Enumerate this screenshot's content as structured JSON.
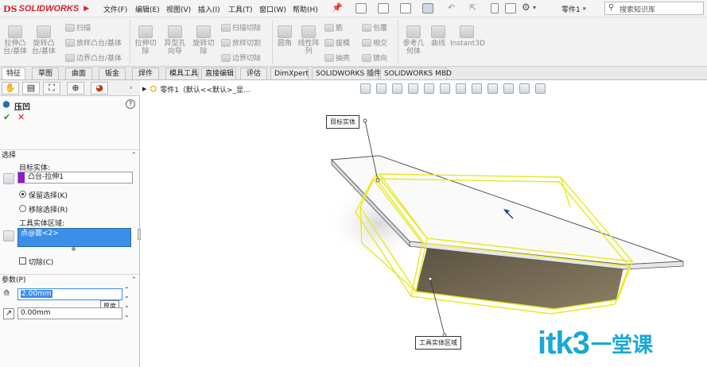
{
  "app": {
    "brand_ds": "DS",
    "brand_name": "SOLIDWORKS"
  },
  "menubar": {
    "items": [
      "文件(F)",
      "编辑(E)",
      "视图(V)",
      "插入(I)",
      "工具(T)",
      "窗口(W)",
      "帮助(H)"
    ],
    "document_name": "零件1 *",
    "search_placeholder": "搜索知识库"
  },
  "ribbon": {
    "large_buttons": [
      {
        "label": "拉伸凸\n台/基体",
        "icon": "extruded-boss-icon"
      },
      {
        "label": "旋转凸\n台/基体",
        "icon": "revolved-boss-icon"
      },
      {
        "label": "拉伸切\n除",
        "icon": "extruded-cut-icon"
      },
      {
        "label": "异型孔\n向导",
        "icon": "hole-wizard-icon"
      },
      {
        "label": "旋转切\n除",
        "icon": "revolved-cut-icon"
      },
      {
        "label": "圆角",
        "icon": "fillet-icon"
      },
      {
        "label": "线性阵\n列",
        "icon": "linear-pattern-icon"
      },
      {
        "label": "参考几\n何体",
        "icon": "reference-geometry-icon"
      },
      {
        "label": "曲线",
        "icon": "curves-icon"
      },
      {
        "label": "Instant3D",
        "icon": "instant3d-icon"
      }
    ],
    "small_buttons": [
      {
        "label": "扫描",
        "icon": "sweep-icon"
      },
      {
        "label": "放样凸台/基体",
        "icon": "loft-icon"
      },
      {
        "label": "边界凸台/基体",
        "icon": "boundary-boss-icon"
      },
      {
        "label": "扫描切除",
        "icon": "swept-cut-icon"
      },
      {
        "label": "放样切割",
        "icon": "lofted-cut-icon"
      },
      {
        "label": "边界切除",
        "icon": "boundary-cut-icon"
      },
      {
        "label": "筋",
        "icon": "rib-icon"
      },
      {
        "label": "拔模",
        "icon": "draft-icon"
      },
      {
        "label": "抽壳",
        "icon": "shell-icon"
      },
      {
        "label": "包覆",
        "icon": "wrap-icon"
      },
      {
        "label": "相交",
        "icon": "intersect-icon"
      },
      {
        "label": "镜向",
        "icon": "mirror-icon"
      }
    ]
  },
  "tabs": [
    "特征",
    "草图",
    "曲面",
    "钣金",
    "焊件",
    "模具工具",
    "直接编辑",
    "评估",
    "DimXpert",
    "SOLIDWORKS 插件",
    "SOLIDWORKS MBD"
  ],
  "property_manager": {
    "title": "压凹",
    "ok": "✔",
    "cancel": "✕",
    "help": "?",
    "selection_header": "选择",
    "target_body_label": "目标实体:",
    "target_body_value": "凸台-拉伸1",
    "target_color": "#8a1ec8",
    "keep_selection": "保留选择(K)",
    "remove_selection": "移除选择(R)",
    "tool_region_label": "工具实体区域:",
    "tool_region_value": "点@面<2>",
    "cut_label": "切除(C)",
    "params_header": "参数(P)",
    "thickness_value": "2.00mm",
    "clearance_value": "0.00mm",
    "tooltip": "厚度"
  },
  "graphics": {
    "tree_item": "零件1（默认<<默认>_显...",
    "callout_target": "目标实体",
    "callout_tool": "工具实体区域"
  },
  "watermark": {
    "main": "itk3",
    "suffix": "一堂课"
  },
  "colors": {
    "brand_red": "#d2232a",
    "highlight_yellow": "#e8e820",
    "selection_blue": "#3b8fe8",
    "plate_gray": "#f4f4f4",
    "shadow_brown": "#6e6450"
  }
}
